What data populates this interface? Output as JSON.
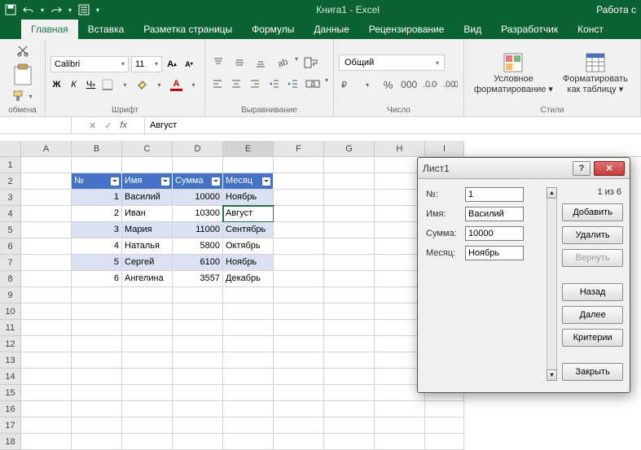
{
  "titlebar": {
    "title": "Книга1 - Excel",
    "right": "Работа с"
  },
  "tabs": {
    "items": [
      {
        "label": "Главная",
        "active": true
      },
      {
        "label": "Вставка"
      },
      {
        "label": "Разметка страницы"
      },
      {
        "label": "Формулы"
      },
      {
        "label": "Данные"
      },
      {
        "label": "Рецензирование"
      },
      {
        "label": "Вид"
      },
      {
        "label": "Разработчик"
      },
      {
        "label": "Конст"
      }
    ]
  },
  "ribbon": {
    "clipboard_label": "обмена",
    "font": {
      "name": "Calibri",
      "size": "11",
      "label": "Шрифт",
      "bold": "Ж",
      "italic": "К",
      "underline": "Ч"
    },
    "alignment_label": "Выравнивание",
    "number": {
      "format": "Общий",
      "label": "Число"
    },
    "styles": {
      "cond": "Условное",
      "cond2": "форматирование",
      "fmt": "Форматировать",
      "fmt2": "как таблицу",
      "label": "Стили"
    }
  },
  "formulabar": {
    "cell": "",
    "value": "Август"
  },
  "columns": [
    "A",
    "B",
    "C",
    "D",
    "E",
    "F",
    "G",
    "H",
    "I"
  ],
  "table": {
    "headers": [
      "№",
      "Имя",
      "Сумма",
      "Месяц"
    ],
    "rows": [
      {
        "n": "1",
        "name": "Василий",
        "sum": "10000",
        "month": "Ноябрь"
      },
      {
        "n": "2",
        "name": "Иван",
        "sum": "10300",
        "month": "Август"
      },
      {
        "n": "3",
        "name": "Мария",
        "sum": "11000",
        "month": "Сентябрь"
      },
      {
        "n": "4",
        "name": "Наталья",
        "sum": "5800",
        "month": "Октябрь"
      },
      {
        "n": "5",
        "name": "Сергей",
        "sum": "6100",
        "month": "Ноябрь"
      },
      {
        "n": "6",
        "name": "Ангелина",
        "sum": "3557",
        "month": "Декабрь"
      }
    ]
  },
  "dialog": {
    "title": "Лист1",
    "counter": "1 из 6",
    "labels": {
      "n": "№:",
      "name": "Имя:",
      "sum": "Сумма:",
      "month": "Месяц:"
    },
    "values": {
      "n": "1",
      "name": "Василий",
      "sum": "10000",
      "month": "Ноябрь"
    },
    "buttons": {
      "add": "Добавить",
      "del": "Удалить",
      "restore": "Вернуть",
      "back": "Назад",
      "next": "Далее",
      "criteria": "Критерии",
      "close": "Закрыть"
    }
  }
}
